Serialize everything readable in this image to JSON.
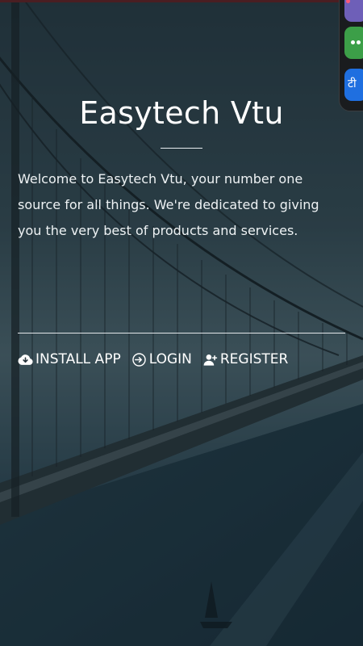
{
  "app": {
    "title": "Easytech Vtu",
    "intro": "Welcome to Easytech Vtu, your number one source for all things. We're dedicated to giving you the very best of products and services."
  },
  "actions": {
    "install_label": "INSTALL APP",
    "login_label": "LOGIN",
    "register_label": "REGISTER"
  },
  "side_dock": {
    "app3_glyph": "टी"
  },
  "colors": {
    "overlay": "#1d2a33",
    "text": "#ffffff",
    "dock_app_1": "#6e5fb8",
    "dock_app_2": "#3c9f48",
    "dock_app_3": "#1f6fe0"
  },
  "icons": {
    "install": "cloud-download-icon",
    "login": "login-icon",
    "register": "user-plus-icon"
  }
}
